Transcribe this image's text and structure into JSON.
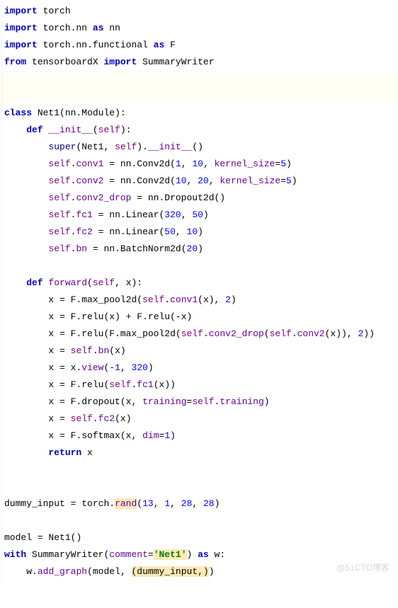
{
  "code": {
    "l1": {
      "kw1": "import",
      "sp1": " ",
      "m1": "torch"
    },
    "l2": {
      "kw1": "import",
      "sp1": " ",
      "m1": "torch.nn",
      "sp2": " ",
      "kw2": "as",
      "sp3": " ",
      "m2": "nn"
    },
    "l3": {
      "kw1": "import",
      "sp1": " ",
      "m1": "torch.nn.functional",
      "sp2": " ",
      "kw2": "as",
      "sp3": " ",
      "m2": "F"
    },
    "l4": {
      "kw1": "from",
      "sp1": " ",
      "m1": "tensorboardX",
      "sp2": " ",
      "kw2": "import",
      "sp3": " ",
      "m2": "SummaryWriter"
    },
    "l7": {
      "kw1": "class",
      "sp1": " ",
      "name": "Net1",
      "p1": "(",
      "base": "nn.Module",
      "p2": "):"
    },
    "l8": {
      "indent": "    ",
      "kw1": "def",
      "sp1": " ",
      "name": "__init__",
      "p1": "(",
      "self": "self",
      "p2": "):"
    },
    "l9": {
      "indent": "        ",
      "fn": "super",
      "p1": "(",
      "a1": "Net1",
      "c1": ", ",
      "self": "self",
      "p2": ").",
      "attr": "__init__",
      "p3": "()"
    },
    "l10": {
      "indent": "        ",
      "self": "self",
      "dot": ".",
      "attr": "conv1",
      "eq": " = ",
      "call": "nn.Conv2d",
      "p1": "(",
      "n1": "1",
      "c1": ", ",
      "n2": "10",
      "c2": ", ",
      "kw": "kernel_size",
      "as": "=",
      "n3": "5",
      "p2": ")"
    },
    "l11": {
      "indent": "        ",
      "self": "self",
      "dot": ".",
      "attr": "conv2",
      "eq": " = ",
      "call": "nn.Conv2d",
      "p1": "(",
      "n1": "10",
      "c1": ", ",
      "n2": "20",
      "c2": ", ",
      "kw": "kernel_size",
      "as": "=",
      "n3": "5",
      "p2": ")"
    },
    "l12": {
      "indent": "        ",
      "self": "self",
      "dot": ".",
      "attr": "conv2_drop",
      "eq": " = ",
      "call": "nn.Dropout2d",
      "p1": "()"
    },
    "l13": {
      "indent": "        ",
      "self": "self",
      "dot": ".",
      "attr": "fc1",
      "eq": " = ",
      "call": "nn.Linear",
      "p1": "(",
      "n1": "320",
      "c1": ", ",
      "n2": "50",
      "p2": ")"
    },
    "l14": {
      "indent": "        ",
      "self": "self",
      "dot": ".",
      "attr": "fc2",
      "eq": " = ",
      "call": "nn.Linear",
      "p1": "(",
      "n1": "50",
      "c1": ", ",
      "n2": "10",
      "p2": ")"
    },
    "l15": {
      "indent": "        ",
      "self": "self",
      "dot": ".",
      "attr": "bn",
      "eq": " = ",
      "call": "nn.BatchNorm2d",
      "p1": "(",
      "n1": "20",
      "p2": ")"
    },
    "l17": {
      "indent": "    ",
      "kw1": "def",
      "sp1": " ",
      "name": "forward",
      "p1": "(",
      "self": "self",
      "c1": ", ",
      "a1": "x",
      "p2": "):"
    },
    "l18": {
      "indent": "        ",
      "x": "x",
      "eq": " = ",
      "call": "F.max_pool2d",
      "p1": "(",
      "self": "self",
      "dot": ".",
      "attr": "conv1",
      "p2": "(",
      "a1": "x",
      "p3": "), ",
      "n1": "2",
      "p4": ")"
    },
    "l19": {
      "indent": "        ",
      "x": "x",
      "eq": " = ",
      "call1": "F.relu",
      "p1": "(",
      "a1": "x",
      "p2": ") + ",
      "call2": "F.relu",
      "p3": "(-",
      "a2": "x",
      "p4": ")"
    },
    "l20": {
      "indent": "        ",
      "x": "x",
      "eq": " = ",
      "call1": "F.relu",
      "p1": "(",
      "call2": "F.max_pool2d",
      "p2": "(",
      "self": "self",
      "dot": ".",
      "attr1": "conv2_drop",
      "p3": "(",
      "self2": "self",
      "dot2": ".",
      "attr2": "conv2",
      "p4": "(",
      "a1": "x",
      "p5": ")), ",
      "n1": "2",
      "p6": "))"
    },
    "l21": {
      "indent": "        ",
      "x": "x",
      "eq": " = ",
      "self": "self",
      "dot": ".",
      "attr": "bn",
      "p1": "(",
      "a1": "x",
      "p2": ")"
    },
    "l22": {
      "indent": "        ",
      "x": "x",
      "eq": " = ",
      "a1": "x",
      "dot": ".",
      "attr": "view",
      "p1": "(",
      "n1": "-1",
      "c1": ", ",
      "n2": "320",
      "p2": ")"
    },
    "l23": {
      "indent": "        ",
      "x": "x",
      "eq": " = ",
      "call": "F.relu",
      "p1": "(",
      "self": "self",
      "dot": ".",
      "attr": "fc1",
      "p2": "(",
      "a1": "x",
      "p3": "))"
    },
    "l24": {
      "indent": "        ",
      "x": "x",
      "eq": " = ",
      "call": "F.dropout",
      "p1": "(",
      "a1": "x",
      "c1": ", ",
      "kw": "training",
      "as": "=",
      "self": "self",
      "dot": ".",
      "attr": "training",
      "p2": ")"
    },
    "l25": {
      "indent": "        ",
      "x": "x",
      "eq": " = ",
      "self": "self",
      "dot": ".",
      "attr": "fc2",
      "p1": "(",
      "a1": "x",
      "p2": ")"
    },
    "l26": {
      "indent": "        ",
      "x": "x",
      "eq": " = ",
      "call": "F.softmax",
      "p1": "(",
      "a1": "x",
      "c1": ", ",
      "kw": "dim",
      "as": "=",
      "n1": "1",
      "p2": ")"
    },
    "l27": {
      "indent": "        ",
      "kw1": "return",
      "sp1": " ",
      "x": "x"
    },
    "l30": {
      "lhs": "dummy_input",
      "eq": " = ",
      "t": "torch",
      "dot": ".",
      "attr": "rand",
      "p1": "(",
      "n1": "13",
      "c1": ", ",
      "n2": "1",
      "c2": ", ",
      "n3": "28",
      "c3": ", ",
      "n4": "28",
      "p2": ")"
    },
    "l32": {
      "lhs": "model",
      "eq": " = ",
      "cls": "Net1",
      "p1": "()"
    },
    "l33": {
      "kw1": "with",
      "sp1": " ",
      "cls": "SummaryWriter",
      "p1": "(",
      "kwarg": "comment",
      "as": "=",
      "str": "'Net1'",
      "p2": ")",
      "sp2": " ",
      "kw2": "as",
      "sp3": " ",
      "v": "w",
      "p3": ":"
    },
    "l34": {
      "indent": "    ",
      "w": "w",
      "dot": ".",
      "attr": "add_graph",
      "p1": "(",
      "a1": "model",
      "c1": ", ",
      "tuple": "(dummy_input,)",
      "p2": ")"
    }
  },
  "watermark": "@51CTO博客"
}
